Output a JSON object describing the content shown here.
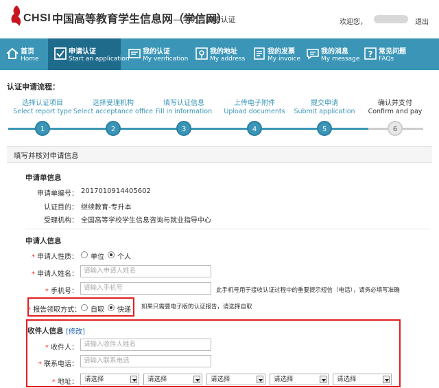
{
  "header": {
    "logo_text": "CHSI",
    "site_title": "中国高等教育学生信息网（学信网）",
    "site_subtitle": "— 学历与成绩认证",
    "welcome": "欢迎您，",
    "logout": "退出"
  },
  "nav": [
    {
      "cn": "首页",
      "en": "Home",
      "icon": "home-icon"
    },
    {
      "cn": "申请认证",
      "en": "Start an application",
      "icon": "checkbox-icon"
    },
    {
      "cn": "我的认证",
      "en": "My verification",
      "icon": "certificate-icon"
    },
    {
      "cn": "我的地址",
      "en": "My address",
      "icon": "location-icon"
    },
    {
      "cn": "我的发票",
      "en": "My invoice",
      "icon": "invoice-icon"
    },
    {
      "cn": "我的消息",
      "en": "My message",
      "icon": "message-icon"
    },
    {
      "cn": "常见问题",
      "en": "FAQs",
      "icon": "question-icon"
    }
  ],
  "flow": {
    "title": "认证申请流程：",
    "steps": [
      {
        "cn": "选择认证项目",
        "en": "Select report type",
        "num": "1"
      },
      {
        "cn": "选择受理机构",
        "en": "Select acceptance office",
        "num": "2"
      },
      {
        "cn": "填写认证信息",
        "en": "Fill in information",
        "num": "3"
      },
      {
        "cn": "上传电子附件",
        "en": "Upload documents",
        "num": "4"
      },
      {
        "cn": "提交申请",
        "en": "Submit application",
        "num": "5"
      },
      {
        "cn": "确认并支付",
        "en": "Confirm and pay",
        "num": "6"
      }
    ]
  },
  "section_title": "填写并核对申请信息",
  "order_info": {
    "title": "申请单信息",
    "number_label": "申请单编号：",
    "number_value": "2017010914405602",
    "purpose_label": "认证目的：",
    "purpose_value": "继续教育-专升本",
    "office_label": "受理机构：",
    "office_value": "全国高等学校学生信息咨询与就业指导中心"
  },
  "applicant": {
    "title": "申请人信息",
    "type_label": "申请人性质：",
    "type_options": [
      "单位",
      "个人"
    ],
    "name_label": "申请人姓名：",
    "name_placeholder": "请输入申请人姓名",
    "phone_label": "手机号：",
    "phone_placeholder": "请输入手机号",
    "phone_hint": "此手机号用于接收认证过程中的重要提示短信（电话），请务必填写准确",
    "pickup_label": "报告领取方式：",
    "pickup_options": [
      "自取",
      "快递"
    ],
    "pickup_hint": "如果只需要电子版的认证报告，请选择自取"
  },
  "recipient": {
    "title": "收件人信息",
    "edit": "[修改]",
    "name_label": "收件人：",
    "name_placeholder": "请输入收件人姓名",
    "phone_label": "联系电话：",
    "phone_placeholder": "请输入联系电话",
    "address_label": "地址：",
    "selects": [
      "请选择",
      "请选择",
      "请选择",
      "请选择",
      "请选择"
    ]
  },
  "colors": {
    "nav": "#3a95b7",
    "nav_active": "#1f6b8c",
    "highlight": "#e01f1f",
    "required": "#e33"
  }
}
